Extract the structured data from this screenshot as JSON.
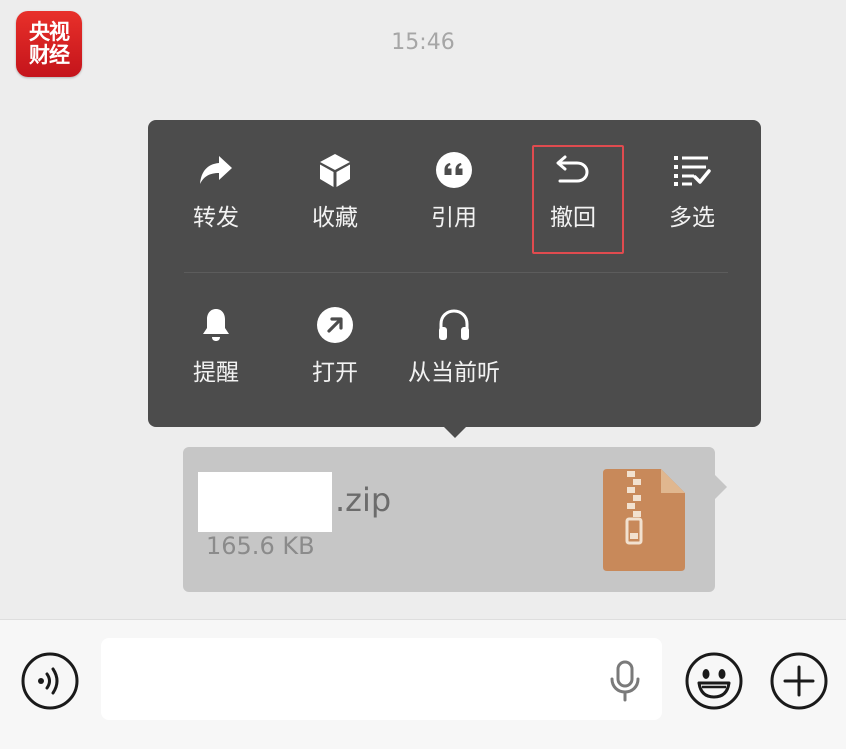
{
  "app_logo": {
    "line1": "央视",
    "line2": "财经",
    "color": "#d8221f"
  },
  "timestamp": "15:46",
  "context_menu": {
    "row1": [
      {
        "label": "转发",
        "icon": "share-arrow-icon"
      },
      {
        "label": "收藏",
        "icon": "cube-icon"
      },
      {
        "label": "引用",
        "icon": "quote-icon"
      },
      {
        "label": "撤回",
        "icon": "undo-arrow-icon",
        "highlighted": true
      },
      {
        "label": "多选",
        "icon": "multi-select-list-icon"
      }
    ],
    "row2": [
      {
        "label": "提醒",
        "icon": "bell-icon"
      },
      {
        "label": "打开",
        "icon": "open-external-icon"
      },
      {
        "label": "从当前听",
        "icon": "headphones-icon"
      }
    ],
    "highlight_color": "#e04b4f"
  },
  "file_message": {
    "extension": ".zip",
    "size": "165.6 KB",
    "icon": "zip-file-icon",
    "icon_color": "#c8895a"
  },
  "input_bar": {
    "voice_icon": "voice-mode-icon",
    "mic_icon": "microphone-icon",
    "emoji_icon": "emoji-icon",
    "plus_icon": "plus-icon",
    "placeholder": ""
  }
}
